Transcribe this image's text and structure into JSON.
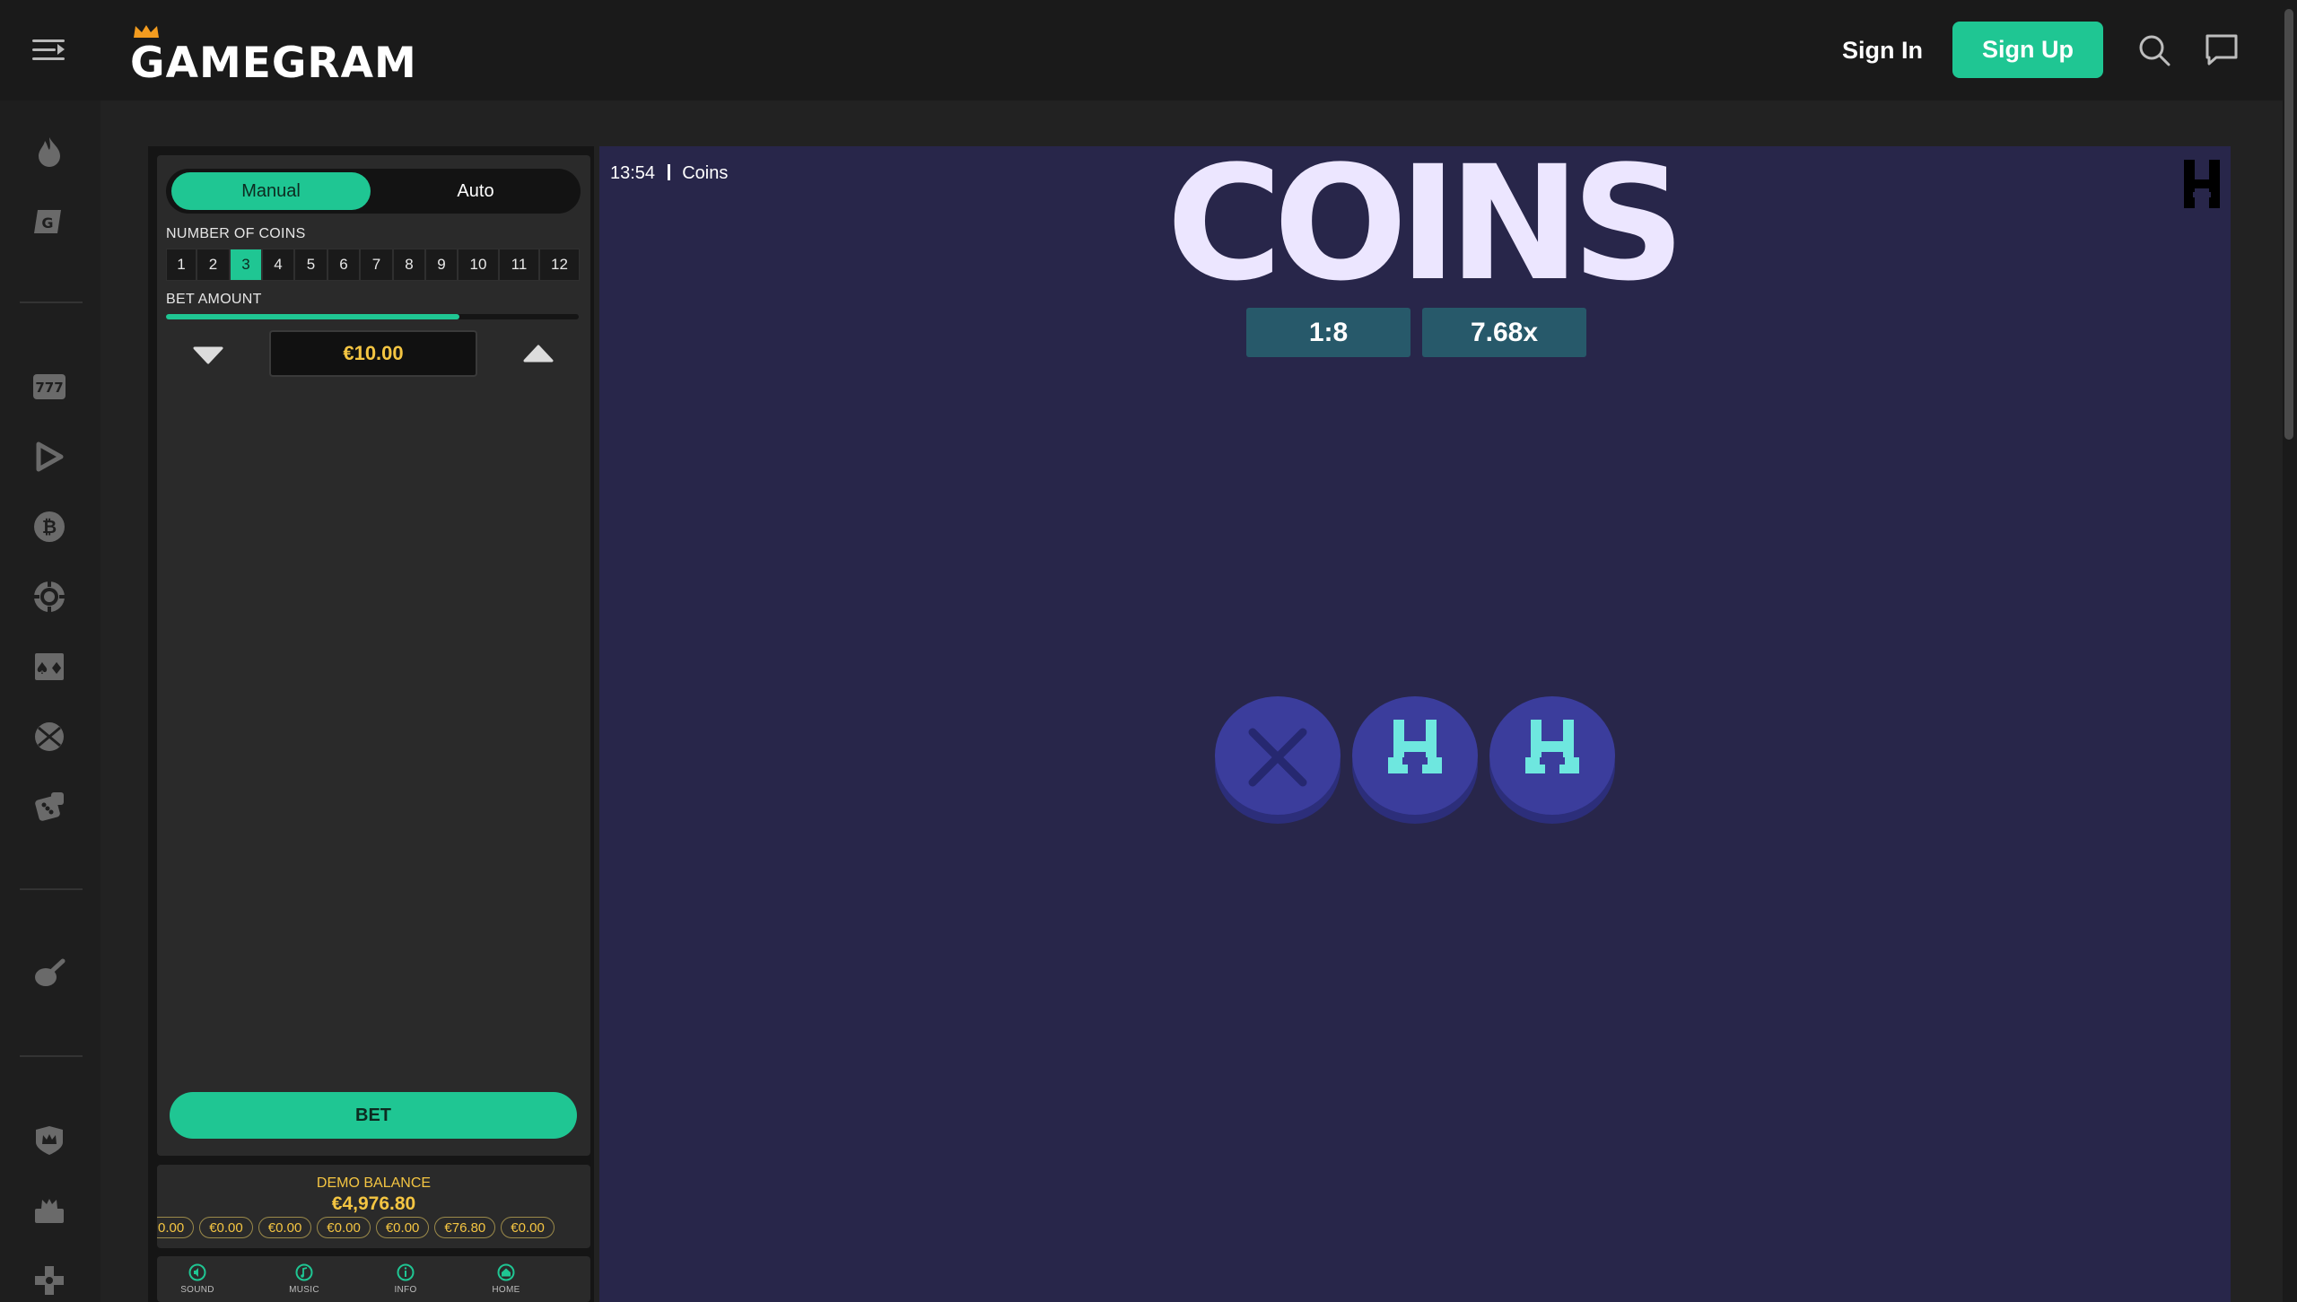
{
  "header": {
    "brand": "GAMEGRAM",
    "signin_label": "Sign In",
    "signup_label": "Sign Up"
  },
  "nav": {
    "icons": [
      "fire-icon",
      "gamegram-originals-icon",
      "slots-777-icon",
      "live-play-icon",
      "bitcoin-icon",
      "roulette-chip-icon",
      "cards-icon",
      "sports-ball-icon",
      "dice-icon",
      "guitar-icon",
      "crown-shield-icon",
      "vip-crown-icon",
      "gamepad-icon"
    ]
  },
  "panel": {
    "mode_manual": "Manual",
    "mode_auto": "Auto",
    "coins_label": "NUMBER OF COINS",
    "coin_counts": [
      "1",
      "2",
      "3",
      "4",
      "5",
      "6",
      "7",
      "8",
      "9",
      "10",
      "11",
      "12"
    ],
    "selected_coins": "3",
    "bet_amount_label": "BET AMOUNT",
    "bet_slider_fraction": 0.71,
    "bet_amount": "€10.00",
    "bet_label": "BET",
    "balance_label": "DEMO BALANCE",
    "balance_value": "€4,976.80",
    "history": [
      "0.00",
      "€0.00",
      "€0.00",
      "€0.00",
      "€0.00",
      "€76.80",
      "€0.00"
    ],
    "footer": {
      "sound": "SOUND",
      "music": "MUSIC",
      "info": "INFO",
      "home": "HOME"
    }
  },
  "game": {
    "clock": "13:54",
    "game_name": "Coins",
    "title": "COINS",
    "odds": "1:8",
    "multiplier": "7.68x",
    "coins": [
      "lose",
      "win",
      "win"
    ]
  },
  "colors": {
    "accent": "#1fc693",
    "gold": "#f4c542",
    "game_bg": "#28264a",
    "coin": "#3b3d9c",
    "coin_symbol": "#6ee7df"
  }
}
